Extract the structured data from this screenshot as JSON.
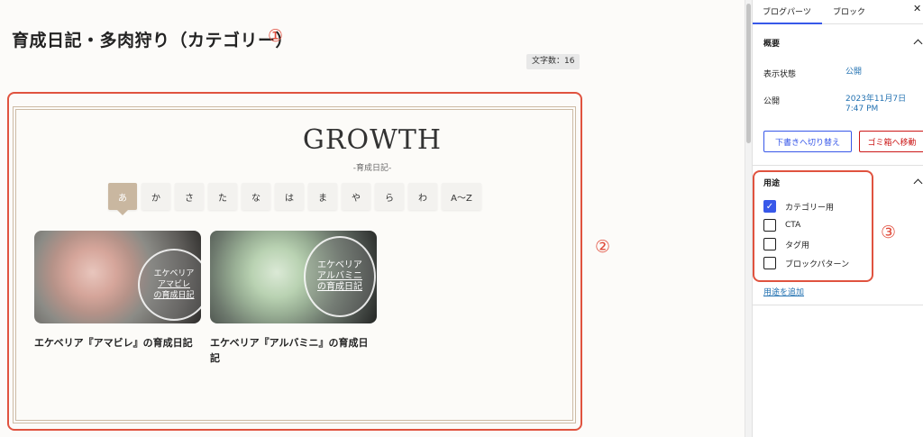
{
  "editor": {
    "title": "育成日記・多肉狩り（カテゴリー）",
    "title_annotation": "①",
    "word_count": "文字数：16",
    "block_annotation": "②",
    "pattern": {
      "heading": "GROWTH",
      "subheading": "-育成日記-",
      "kana_tabs": [
        "あ",
        "か",
        "さ",
        "た",
        "な",
        "は",
        "ま",
        "や",
        "ら",
        "わ",
        "A〜Z"
      ],
      "active_tab_index": 0,
      "cards": [
        {
          "circle_lines": [
            "エケベリア",
            "アマビレ",
            "の育成日記"
          ],
          "title": "エケベリア『アマビレ』の育成日記"
        },
        {
          "circle_lines": [
            "エケベリア",
            "アルバミニ",
            "の育成日記"
          ],
          "title": "エケベリア『アルバミニ』の育成日記"
        }
      ]
    }
  },
  "sidebar": {
    "tabs": [
      "ブログパーツ",
      "ブロック"
    ],
    "close_icon": "close-icon",
    "summary": {
      "heading": "概要",
      "visibility_label": "表示状態",
      "visibility_value": "公開",
      "publish_label": "公開",
      "publish_date": "2023年11月7日",
      "publish_time": "7:47 PM",
      "draft_button": "下書きへ切り替え",
      "trash_button": "ゴミ箱へ移動"
    },
    "usage": {
      "heading": "用途",
      "annotation": "③",
      "options": [
        {
          "label": "カテゴリー用",
          "checked": true
        },
        {
          "label": "CTA",
          "checked": false
        },
        {
          "label": "タグ用",
          "checked": false
        },
        {
          "label": "ブロックパターン",
          "checked": false
        }
      ],
      "add_link": "用途を追加"
    }
  },
  "colors": {
    "annotation_red": "#e04c3c",
    "accent_blue": "#3858e9",
    "link_blue": "#2271b1",
    "frame_beige": "#cdbba5",
    "danger_red": "#cc1818"
  }
}
